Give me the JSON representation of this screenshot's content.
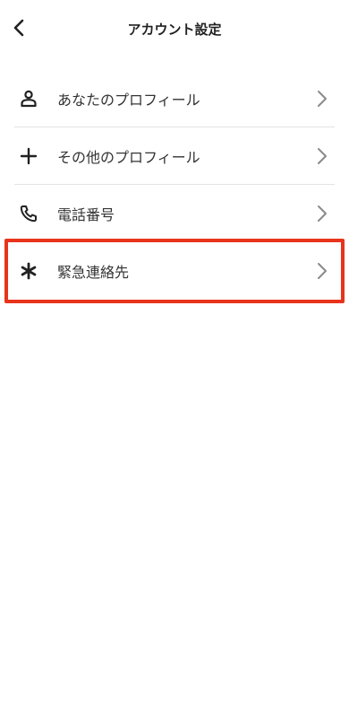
{
  "header": {
    "title": "アカウント設定",
    "back_icon": "chevron-left-icon"
  },
  "items": [
    {
      "label": "あなたのプロフィール",
      "icon": "person-icon"
    },
    {
      "label": "その他のプロフィール",
      "icon": "plus-icon"
    },
    {
      "label": "電話番号",
      "icon": "phone-icon"
    },
    {
      "label": "緊急連絡先",
      "icon": "asterisk-icon"
    }
  ],
  "colors": {
    "highlight_border": "#e8341c",
    "divider": "#e3e3e3",
    "chevron": "#8a8a8a"
  }
}
